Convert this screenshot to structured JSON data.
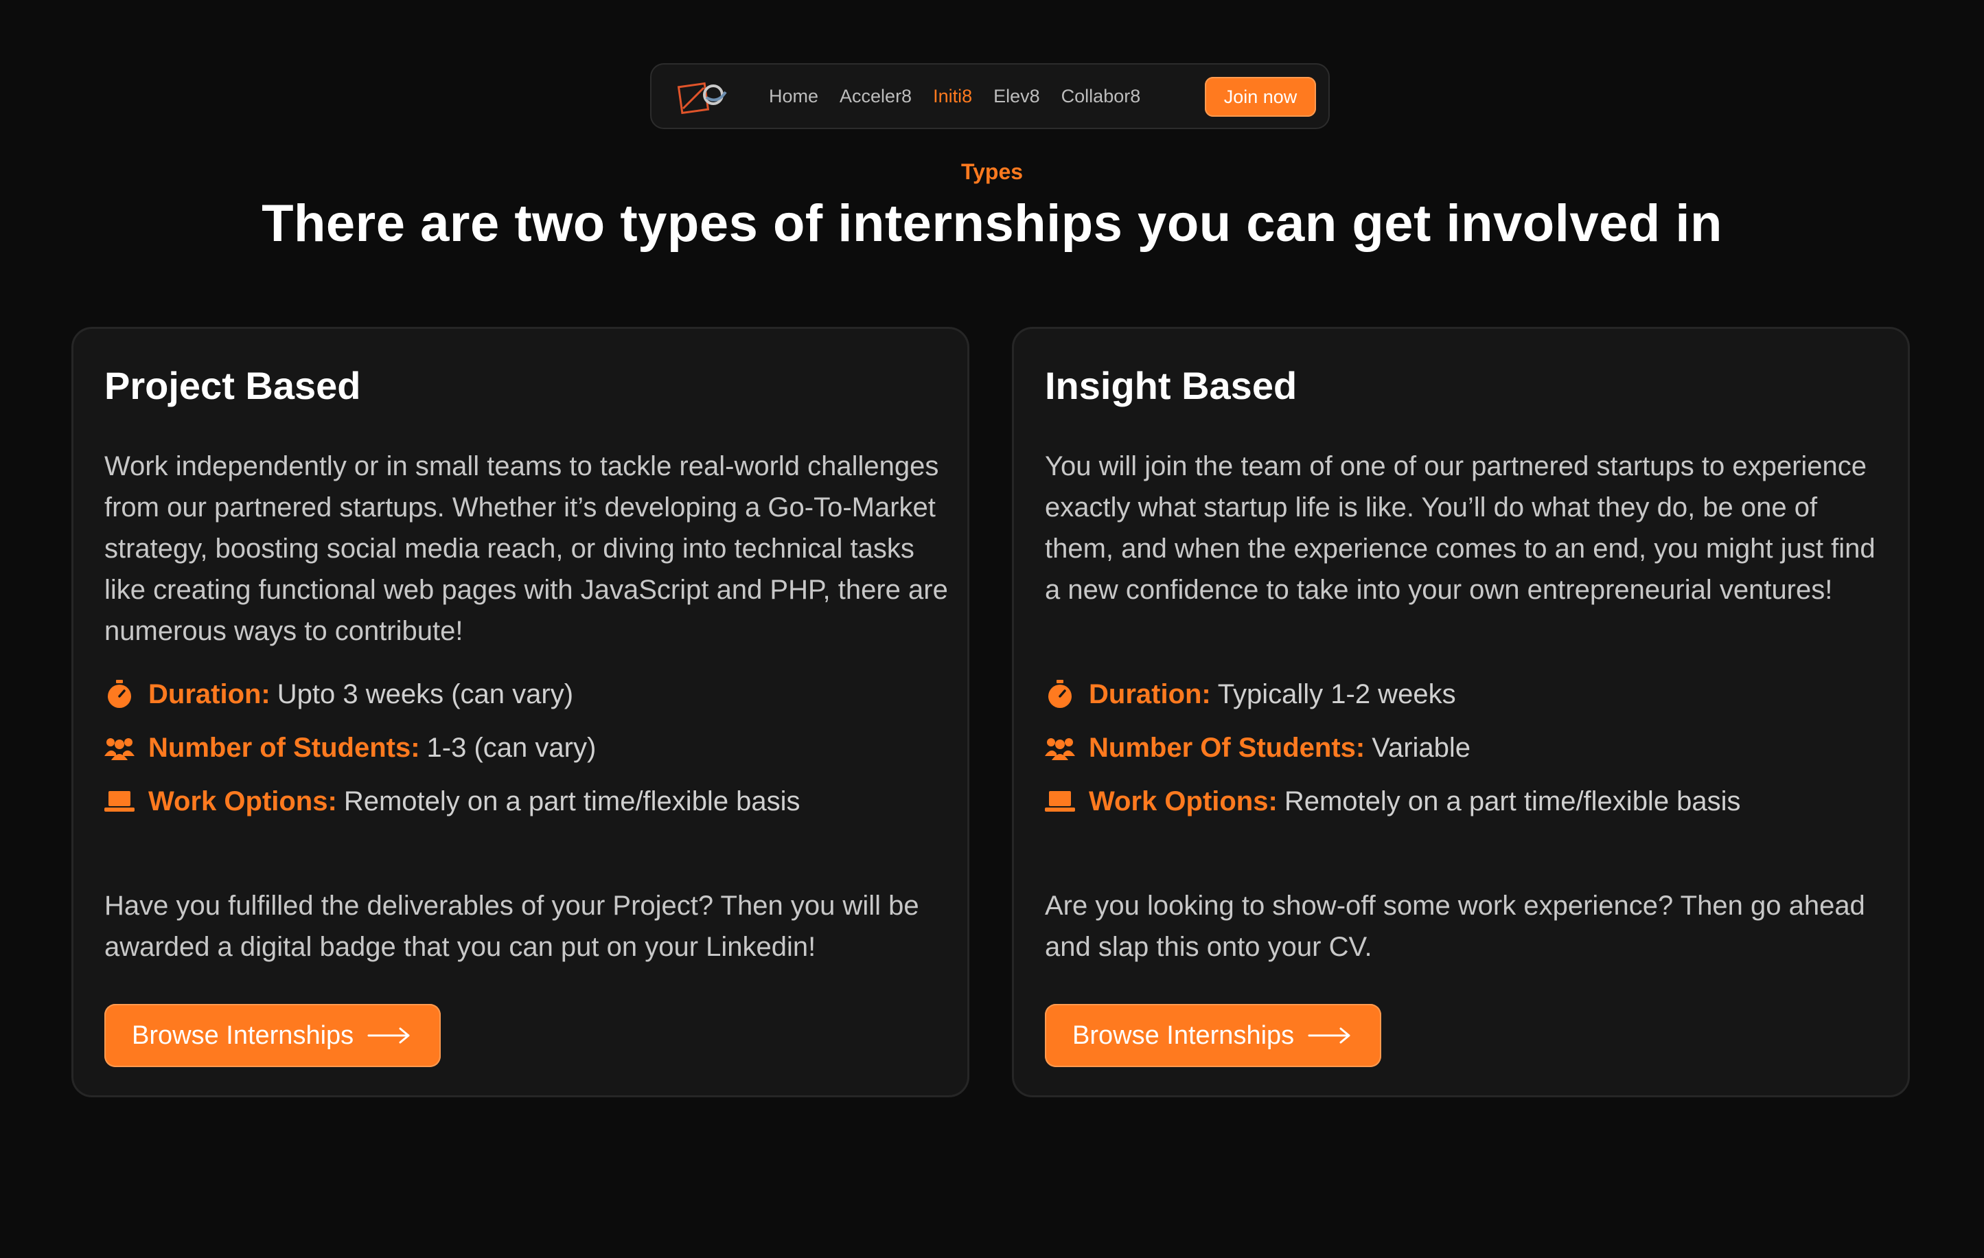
{
  "nav": {
    "links": [
      {
        "label": "Home",
        "active": false
      },
      {
        "label": "Acceler8",
        "active": false
      },
      {
        "label": "Initi8",
        "active": true
      },
      {
        "label": "Elev8",
        "active": false
      },
      {
        "label": "Collabor8",
        "active": false
      }
    ],
    "join_label": "Join now"
  },
  "section": {
    "eyebrow": "Types",
    "headline": "There are two types of internships you can get involved in"
  },
  "cards": [
    {
      "title": "Project Based",
      "description": "Work independently or in small teams to tackle real-world challenges from our partnered startups. Whether it’s developing a Go-To-Market strategy, boosting social media reach, or diving into technical tasks like creating functional web pages with JavaScript and PHP, there are numerous ways to contribute!",
      "meta": [
        {
          "icon": "stopwatch-icon",
          "label": "Duration:",
          "value": "Upto 3 weeks (can vary)"
        },
        {
          "icon": "group-icon",
          "label": "Number of Students:",
          "value": "1-3 (can vary)"
        },
        {
          "icon": "laptop-icon",
          "label": "Work Options:",
          "value": "Remotely on a part time/flexible basis"
        }
      ],
      "footer": "Have you fulfilled the deliverables of your Project? Then you will be awarded a digital badge that you can put on your Linkedin!",
      "button_label": "Browse Internships"
    },
    {
      "title": "Insight Based",
      "description": "You will join the team of one of our partnered startups to experience exactly what startup life is like. You’ll do what they do, be one of them, and when the experience comes to an end, you might just find a new confidence to take into your own entrepreneurial ventures!",
      "meta": [
        {
          "icon": "stopwatch-icon",
          "label": "Duration:",
          "value": "Typically 1-2 weeks"
        },
        {
          "icon": "group-icon",
          "label": "Number Of Students:",
          "value": "Variable"
        },
        {
          "icon": "laptop-icon",
          "label": "Work Options:",
          "value": "Remotely on a part time/flexible basis"
        }
      ],
      "footer": "Are you looking to show-off some work experience? Then go ahead and slap this onto your CV.",
      "button_label": "Browse Internships"
    }
  ],
  "colors": {
    "accent": "#ff7a1f",
    "background": "#0c0c0c",
    "card": "#161616"
  }
}
